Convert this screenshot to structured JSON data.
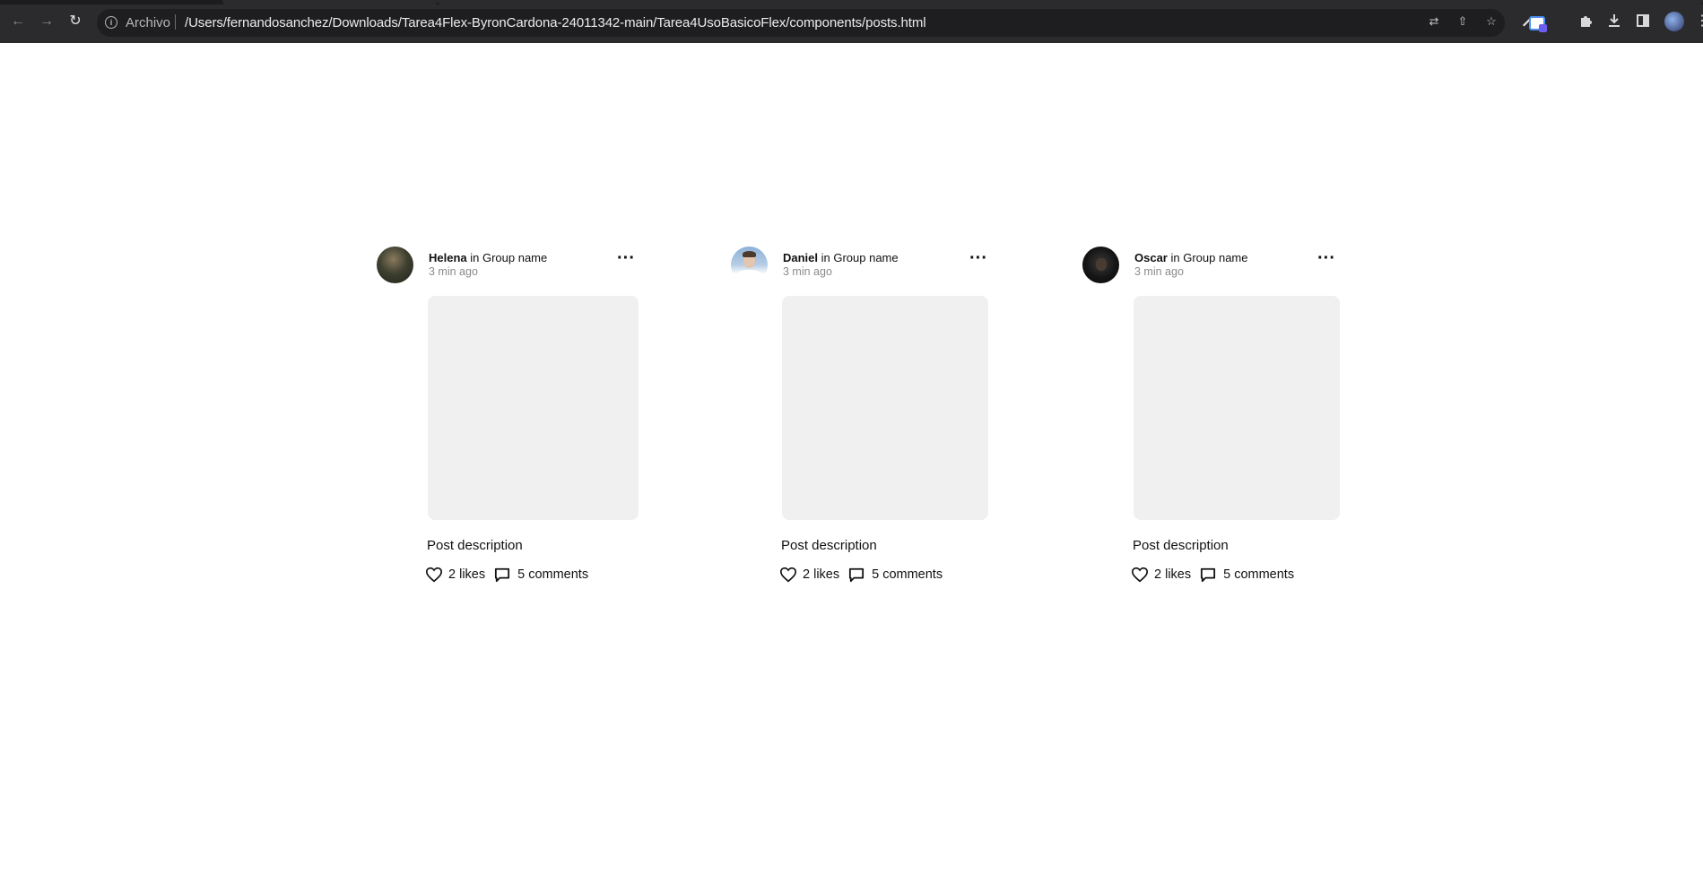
{
  "browser": {
    "site_label": "Archivo",
    "url": "/Users/fernandosanchez/Downloads/Tarea4Flex-ByronCardona-24011342-main/Tarea4UsoBasicoFlex/components/posts.html"
  },
  "posts": [
    {
      "author": "Helena",
      "connector": " in ",
      "group": "Group name",
      "time": "3 min ago",
      "description": "Post description",
      "likes": "2 likes",
      "comments": "5 comments"
    },
    {
      "author": "Daniel",
      "connector": " in ",
      "group": "Group name",
      "time": "3 min ago",
      "description": "Post description",
      "likes": "2 likes",
      "comments": "5 comments"
    },
    {
      "author": "Oscar",
      "connector": " in ",
      "group": "Group name",
      "time": "3 min ago",
      "description": "Post description",
      "likes": "2 likes",
      "comments": "5 comments"
    }
  ],
  "icons": {
    "back": "arrow-left-icon",
    "forward": "arrow-right-icon",
    "reload": "reload-icon",
    "info": "info-icon",
    "translate": "translate-icon",
    "share": "share-icon",
    "bookmark": "star-icon",
    "extensions": "puzzle-icon",
    "download": "download-icon",
    "sidepanel": "side-panel-icon",
    "more_options": "more-horizontal-icon",
    "like": "heart-icon",
    "comment": "comment-icon"
  },
  "colors": {
    "chrome_bg": "#2b2b2d",
    "omnibox_bg": "#1e1e20",
    "image_placeholder": "#f0f0f0",
    "muted_text": "#8a8a8a"
  }
}
